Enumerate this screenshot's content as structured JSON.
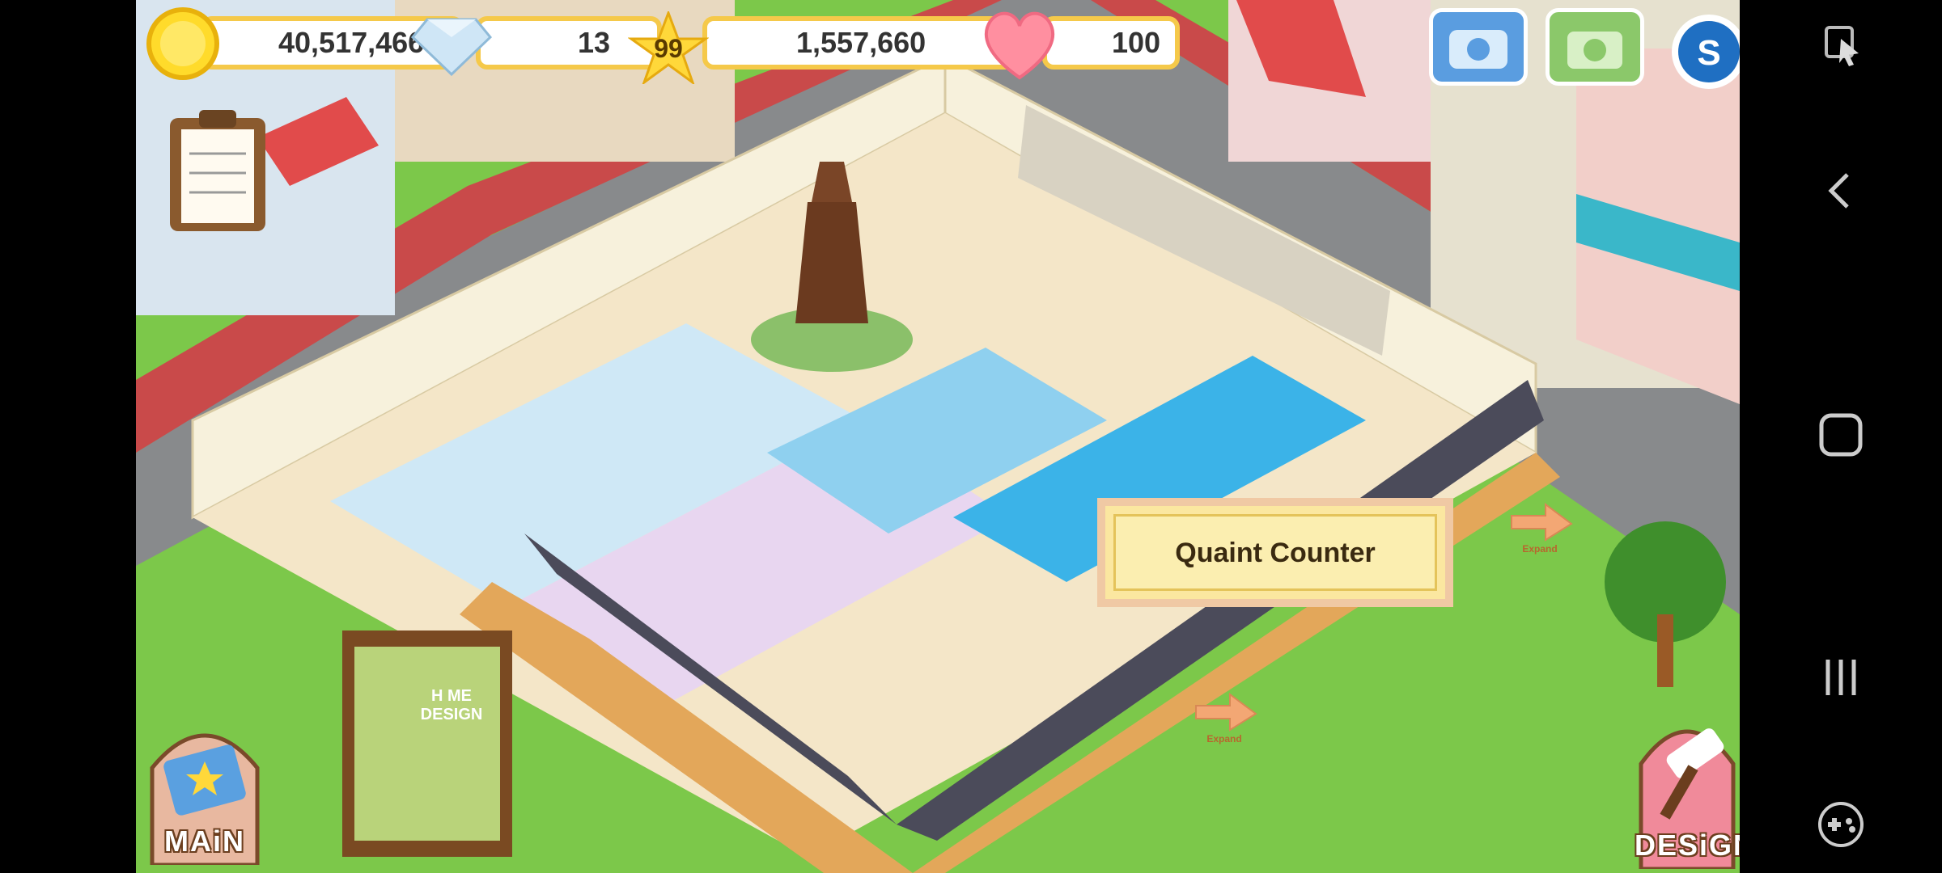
{
  "hud": {
    "coins": "40,517,466",
    "gems": "13",
    "level": "99",
    "xp": "1,557,660",
    "hearts": "100"
  },
  "tooltip": {
    "label": "Quaint Counter"
  },
  "buttons": {
    "main_label": "MAiN",
    "design_label": "DESiGN",
    "expand_label": "Expand"
  },
  "billboard": {
    "line1": "H ME",
    "line2": "DESIGN"
  },
  "icons": {
    "coin": "coin-icon",
    "gem": "diamond-icon",
    "star": "star-icon",
    "heart": "heart-icon",
    "phone": "phone-icon",
    "camera": "camera-icon",
    "social": "s-logo-icon",
    "clipboard": "clipboard-icon"
  },
  "colors": {
    "grass": "#7cc84a",
    "hud_border": "#f5c94a",
    "tooltip_bg": "#fbe7a0",
    "floor_blue": "#3bb3e8",
    "wall_cream": "#f7f1dc"
  }
}
